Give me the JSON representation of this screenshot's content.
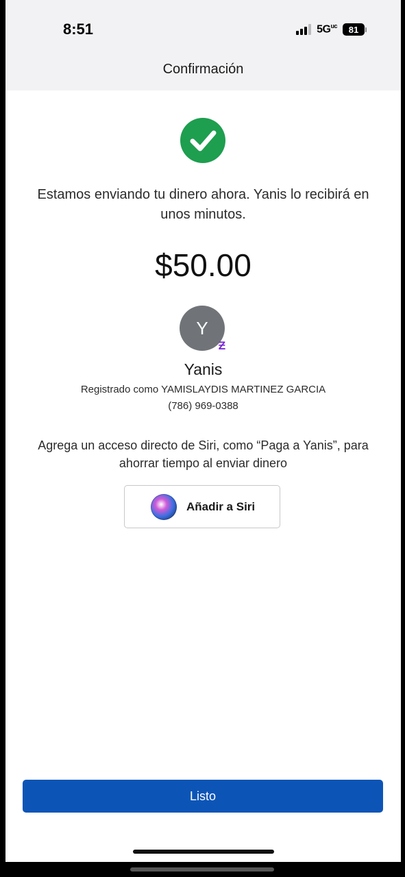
{
  "status_bar": {
    "time": "8:51",
    "network": "5G",
    "network_suffix": "uc",
    "battery": "81"
  },
  "header": {
    "title": "Confirmación"
  },
  "confirmation": {
    "message": "Estamos enviando tu dinero ahora. Yanis lo recibirá en unos minutos.",
    "amount": "$50.00",
    "success_color": "#1e9e4f"
  },
  "recipient": {
    "initial": "Y",
    "badge": "Ƶ",
    "name": "Yanis",
    "registered_as": "Registrado como YAMISLAYDIS MARTINEZ GARCIA",
    "phone": "(786) 969-0388"
  },
  "siri": {
    "note": "Agrega un acceso directo de Siri, como “Paga a Yanis”, para ahorrar tiempo al enviar dinero",
    "button_label": "Añadir a Siri",
    "icon": "siri-icon"
  },
  "actions": {
    "done_label": "Listo",
    "accent_color": "#0c55b7"
  }
}
